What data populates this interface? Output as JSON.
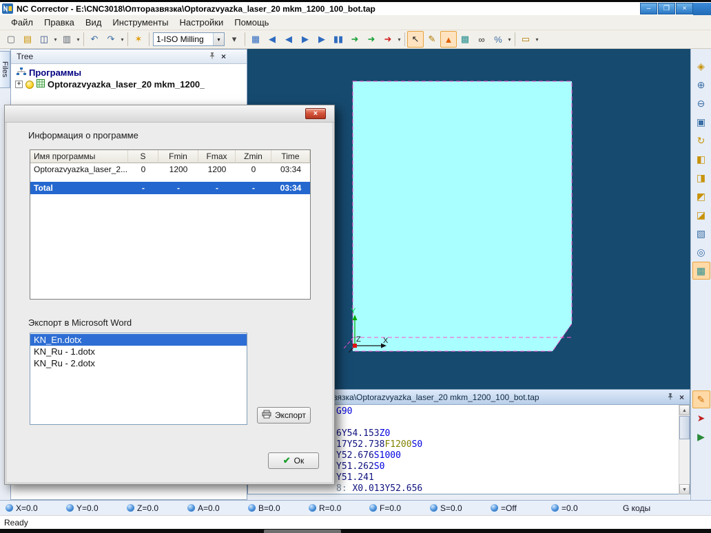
{
  "window": {
    "title": "NC Corrector - E:\\CNC3018\\Опторазвязка\\Optorazvyazka_laser_20 mkm_1200_100_bot.tap",
    "minimize": "–",
    "restore": "❐",
    "close": "×"
  },
  "ui": {
    "dropdown": "▾",
    "close_panel": "×",
    "scroll_up": "▲",
    "scroll_down": "▼",
    "expand": "+"
  },
  "menu": [
    {
      "id": "file",
      "label": "Файл"
    },
    {
      "id": "edit",
      "label": "Правка"
    },
    {
      "id": "view",
      "label": "Вид"
    },
    {
      "id": "tools",
      "label": "Инструменты"
    },
    {
      "id": "settings",
      "label": "Настройки"
    },
    {
      "id": "help",
      "label": "Помощь"
    }
  ],
  "toolbar": {
    "machine_preset": "1-ISO Milling",
    "items": [
      {
        "id": "new-file",
        "glyph": "▢",
        "color": "#5a6470"
      },
      {
        "id": "open-file",
        "glyph": "▤",
        "color": "#c9930a"
      },
      {
        "id": "save-file",
        "glyph": "◫",
        "color": "#33508c",
        "dd": true
      },
      {
        "id": "print",
        "glyph": "▥",
        "color": "#5a6470",
        "dd": true
      },
      {
        "sep": true
      },
      {
        "id": "undo",
        "glyph": "↶",
        "color": "#3a6ea5"
      },
      {
        "id": "redo",
        "glyph": "↷",
        "color": "#3a6ea5",
        "dd": true
      },
      {
        "sep": true
      },
      {
        "id": "tools",
        "glyph": "✶",
        "color": "#e09a00"
      },
      {
        "sep": true
      },
      {
        "combo": true
      },
      {
        "id": "preset-extra",
        "glyph": "▾",
        "color": "#444444"
      },
      {
        "sep": true
      },
      {
        "id": "grid-view",
        "glyph": "▦",
        "color": "#2f6bbf"
      },
      {
        "id": "go-first",
        "glyph": "◀",
        "color": "#2f6bbf"
      },
      {
        "id": "step-back",
        "glyph": "◀",
        "color": "#2f6bbf"
      },
      {
        "id": "step-forward",
        "glyph": "▶",
        "color": "#2f6bbf"
      },
      {
        "id": "go-last",
        "glyph": "▶",
        "color": "#2f6bbf"
      },
      {
        "id": "pause",
        "glyph": "▮▮",
        "color": "#2f6bbf"
      },
      {
        "id": "run",
        "glyph": "➜",
        "color": "#18a038"
      },
      {
        "id": "run-from",
        "glyph": "➜",
        "color": "#18a038"
      },
      {
        "id": "stop",
        "glyph": "➜",
        "color": "#d02020",
        "dd": true
      },
      {
        "sep": true
      },
      {
        "id": "select-cursor",
        "glyph": "↖",
        "color": "#222222",
        "sel": true
      },
      {
        "id": "edit-draw",
        "glyph": "✎",
        "color": "#b07a00"
      },
      {
        "id": "highlight-tool",
        "glyph": "▲",
        "color": "#e06000",
        "sel": true
      },
      {
        "id": "table-view",
        "glyph": "▩",
        "color": "#2a9090"
      },
      {
        "id": "compare-view",
        "glyph": "∞",
        "color": "#333333"
      },
      {
        "id": "scale-tool",
        "glyph": "%",
        "color": "#3a6ea5",
        "dd": true
      },
      {
        "sep": true
      },
      {
        "id": "measure-tool",
        "glyph": "▭",
        "color": "#b07a00",
        "dd": true
      }
    ]
  },
  "right_toolbar": [
    {
      "id": "fit-view",
      "glyph": "◈",
      "color": "#c9930a"
    },
    {
      "id": "zoom-in",
      "glyph": "⊕",
      "color": "#3a6ea5"
    },
    {
      "id": "zoom-out",
      "glyph": "⊖",
      "color": "#3a6ea5"
    },
    {
      "id": "zoom-window",
      "glyph": "▣",
      "color": "#3a6ea5"
    },
    {
      "id": "rotate-view",
      "glyph": "↻",
      "color": "#c9930a"
    },
    {
      "id": "view-top",
      "glyph": "◧",
      "color": "#c9930a"
    },
    {
      "id": "view-front",
      "glyph": "◨",
      "color": "#c9930a"
    },
    {
      "id": "view-side",
      "glyph": "◩",
      "color": "#c9930a"
    },
    {
      "id": "view-iso",
      "glyph": "◪",
      "color": "#c9930a"
    },
    {
      "id": "wireframe-mode",
      "glyph": "▧",
      "color": "#3a6ea5"
    },
    {
      "id": "zoom-selection",
      "glyph": "◎",
      "color": "#3a6ea5"
    },
    {
      "id": "region-select",
      "glyph": "▦",
      "color": "#2a9090",
      "sel": true
    },
    {
      "gap": 160
    },
    {
      "id": "edit-gcode",
      "glyph": "✎",
      "color": "#d07000",
      "sel": true
    },
    {
      "id": "backplot",
      "glyph": "➤",
      "color": "#c02020"
    },
    {
      "id": "simulate",
      "glyph": "▶",
      "color": "#2a8a3a"
    }
  ],
  "tree": {
    "files_tab": "Files",
    "title": "Tree",
    "root": "Программы",
    "program": "Optorazvyazka_laser_20 mkm_1200_"
  },
  "viewport": {
    "axis_x": "X",
    "axis_y": "Y",
    "axis_z": "Z"
  },
  "dialog": {
    "close": "×",
    "info_label": "Информация о программе",
    "table": {
      "headers": [
        "Имя программы",
        "S",
        "Fmin",
        "Fmax",
        "Zmin",
        "Time"
      ],
      "rows": [
        [
          "Optorazvyazka_laser_2...",
          "0",
          "1200",
          "1200",
          "0",
          "03:34"
        ]
      ],
      "total_row": [
        "Total",
        "-",
        "-",
        "-",
        "-",
        "03:34"
      ]
    },
    "export_label": "Экспорт в Microsoft Word",
    "templates": [
      "KN_En.dotx",
      "KN_Ru - 1.dotx",
      "KN_Ru - 2.dotx"
    ],
    "selected_template": "KN_En.dotx",
    "export_button": "Экспорт",
    "ok_button": "Ок"
  },
  "code_panel": {
    "title": "E:\\CNC3018\\Опторазвязка\\Optorazvyazka_laser_20 mkm_1200_100_bot.tap",
    "lines": [
      [
        [
          "g",
          "G90"
        ]
      ],
      [],
      [
        [
          "c",
          "6Y54.153"
        ],
        [
          "g",
          "Z0"
        ]
      ],
      [
        [
          "c",
          "17Y52.738"
        ],
        [
          "f",
          "F1200"
        ],
        [
          "g",
          "S0"
        ]
      ],
      [
        [
          "c",
          "Y52.676"
        ],
        [
          "g",
          "S1000"
        ]
      ],
      [
        [
          "c",
          "Y51.262"
        ],
        [
          "g",
          "S0"
        ]
      ],
      [
        [
          "c",
          "Y51.241"
        ]
      ],
      [
        [
          "n",
          "8: "
        ],
        [
          "c",
          "X0.013Y52.656"
        ]
      ]
    ]
  },
  "status": {
    "fields": [
      {
        "id": "x-axis",
        "label": "X=0.0"
      },
      {
        "id": "y-axis",
        "label": "Y=0.0"
      },
      {
        "id": "z-axis",
        "label": "Z=0.0"
      },
      {
        "id": "a-axis",
        "label": "A=0.0"
      },
      {
        "id": "b-axis",
        "label": "B=0.0"
      },
      {
        "id": "r-value",
        "label": "R=0.0"
      },
      {
        "id": "f-value",
        "label": "F=0.0"
      },
      {
        "id": "s-value",
        "label": "S=0.0"
      },
      {
        "id": "spindle",
        "label": "=Off",
        "icon": "spindle-icon"
      },
      {
        "id": "time",
        "label": "=0.0",
        "icon": "clock-icon"
      }
    ],
    "gcodes": "G коды",
    "ready": "Ready"
  }
}
